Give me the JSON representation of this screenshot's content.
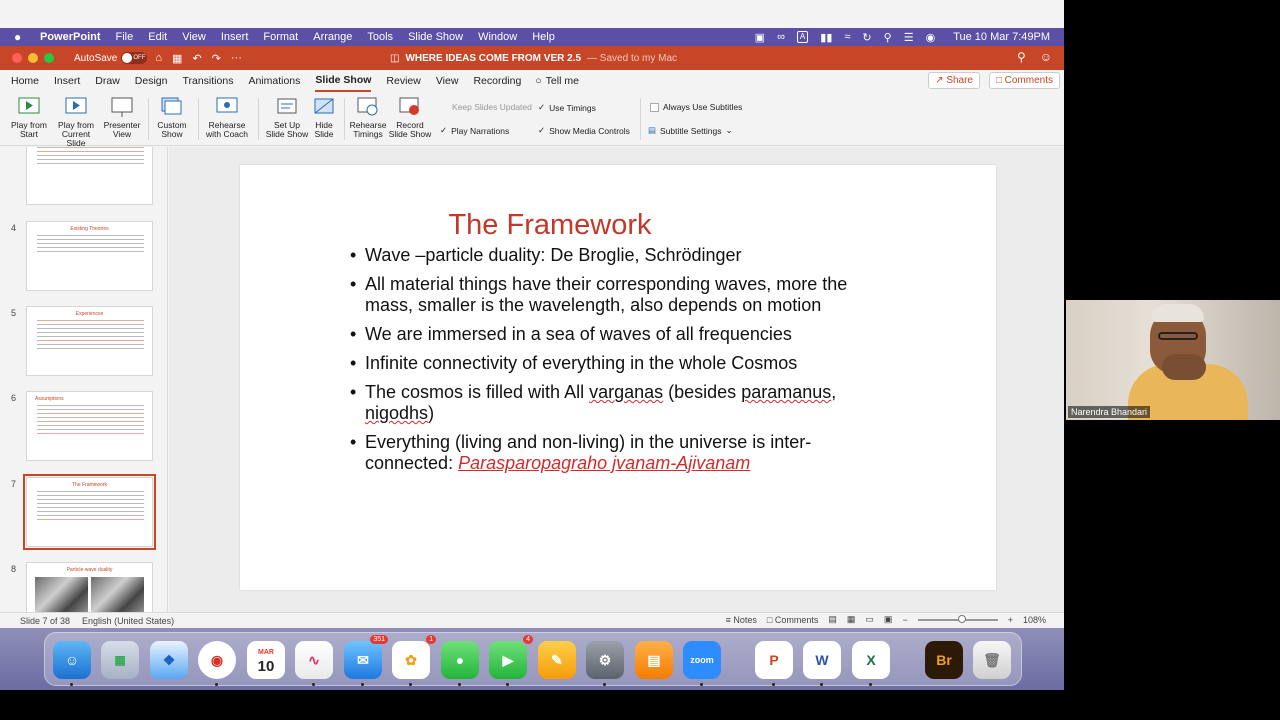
{
  "menubar": {
    "app_name": "PowerPoint",
    "items": [
      "File",
      "Edit",
      "View",
      "Insert",
      "Format",
      "Arrange",
      "Tools",
      "Slide Show",
      "Window",
      "Help"
    ],
    "input_indicator": "A",
    "clock": "Tue 10 Mar  7:49PM"
  },
  "titlebar": {
    "autosave_label": "AutoSave",
    "autosave_state": "OFF",
    "doc_title": "WHERE IDEAS COME FROM VER 2.5",
    "saved_status": "— Saved to my Mac"
  },
  "tabs": {
    "items": [
      "Home",
      "Insert",
      "Draw",
      "Design",
      "Transitions",
      "Animations",
      "Slide Show",
      "Review",
      "View",
      "Recording"
    ],
    "active": "Slide Show",
    "tell_me": "Tell me",
    "share_label": "Share",
    "comments_label": "Comments"
  },
  "ribbon": {
    "play_from_start": [
      "Play from",
      "Start"
    ],
    "play_from_current": [
      "Play from",
      "Current Slide"
    ],
    "presenter_view": [
      "Presenter",
      "View"
    ],
    "custom_show": [
      "Custom",
      "Show"
    ],
    "rehearse_with_coach": [
      "Rehearse",
      "with Coach"
    ],
    "setup_slideshow": [
      "Set Up",
      "Slide Show"
    ],
    "hide_slide": [
      "Hide",
      "Slide"
    ],
    "rehearse_timings": [
      "Rehearse",
      "Timings"
    ],
    "record_slideshow": [
      "Record",
      "Slide Show"
    ],
    "keep_slides_updated": "Keep Slides Updated",
    "use_timings": "Use Timings",
    "play_narrations": "Play Narrations",
    "show_media_controls": "Show Media Controls",
    "always_use_subtitles": "Always Use Subtitles",
    "subtitle_settings": "Subtitle Settings"
  },
  "thumbnails": [
    {
      "num": "",
      "title": "",
      "lines": 6
    },
    {
      "num": "4",
      "title": "Existing Theories",
      "lines": 6
    },
    {
      "num": "5",
      "title": "Experiences",
      "lines": 9
    },
    {
      "num": "6",
      "title": "Assumptions",
      "lines": 9
    },
    {
      "num": "7",
      "title": "The Framework",
      "lines": 9,
      "active": true
    },
    {
      "num": "8",
      "title": "Particle-wave duality",
      "lines": 0
    }
  ],
  "slide": {
    "title": "The Framework",
    "bullets": [
      {
        "text": "Wave –particle duality: De Broglie, Schrödinger"
      },
      {
        "text": "All material things have  their corresponding waves, more the mass, smaller  is the wavelength, also depends on motion"
      },
      {
        "text": "We are immersed in a sea of waves of all frequencies"
      },
      {
        "text": "Infinite connectivity of everything in the  whole Cosmos"
      },
      {
        "pre": "The cosmos is filled with All ",
        "w1": "varganas",
        "mid": " (besides ",
        "w2": "paramanus",
        "mid2": ", ",
        "w3": "nigodhs",
        "post": ")"
      },
      {
        "pre": "Everything (living  and non-living) in the universe is inter-connected: ",
        "link": "Parasparopagraho jvanam-Ajivanam"
      }
    ]
  },
  "statusbar": {
    "slide_count": "Slide 7 of 38",
    "language": "English (United States)",
    "notes": "Notes",
    "comments": "Comments",
    "zoom_fraction": 0.55,
    "zoom": "108%"
  },
  "dock": {
    "calendar_month": "MAR",
    "calendar_day": "10",
    "mail_badge": "351",
    "photos_badge": "1",
    "facetime_badge": "4",
    "zoom_label": "zoom",
    "bridge_label": "Br"
  },
  "webcam": {
    "participant_name": "Narendra Bhandari"
  }
}
